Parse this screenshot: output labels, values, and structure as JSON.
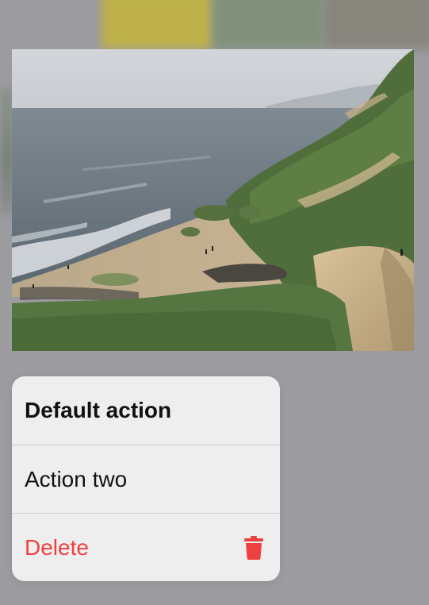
{
  "preview": {
    "image_icon": "landscape-photo"
  },
  "menu": {
    "items": [
      {
        "label": "Default action",
        "style": "bold"
      },
      {
        "label": "Action two",
        "style": "normal"
      },
      {
        "label": "Delete",
        "style": "destructive",
        "icon": "trash-icon"
      }
    ]
  },
  "colors": {
    "backdrop": "#9c9ba0",
    "menu_background": "#eeeeef",
    "destructive": "#ef4040",
    "separator": "#cfcfd3"
  }
}
